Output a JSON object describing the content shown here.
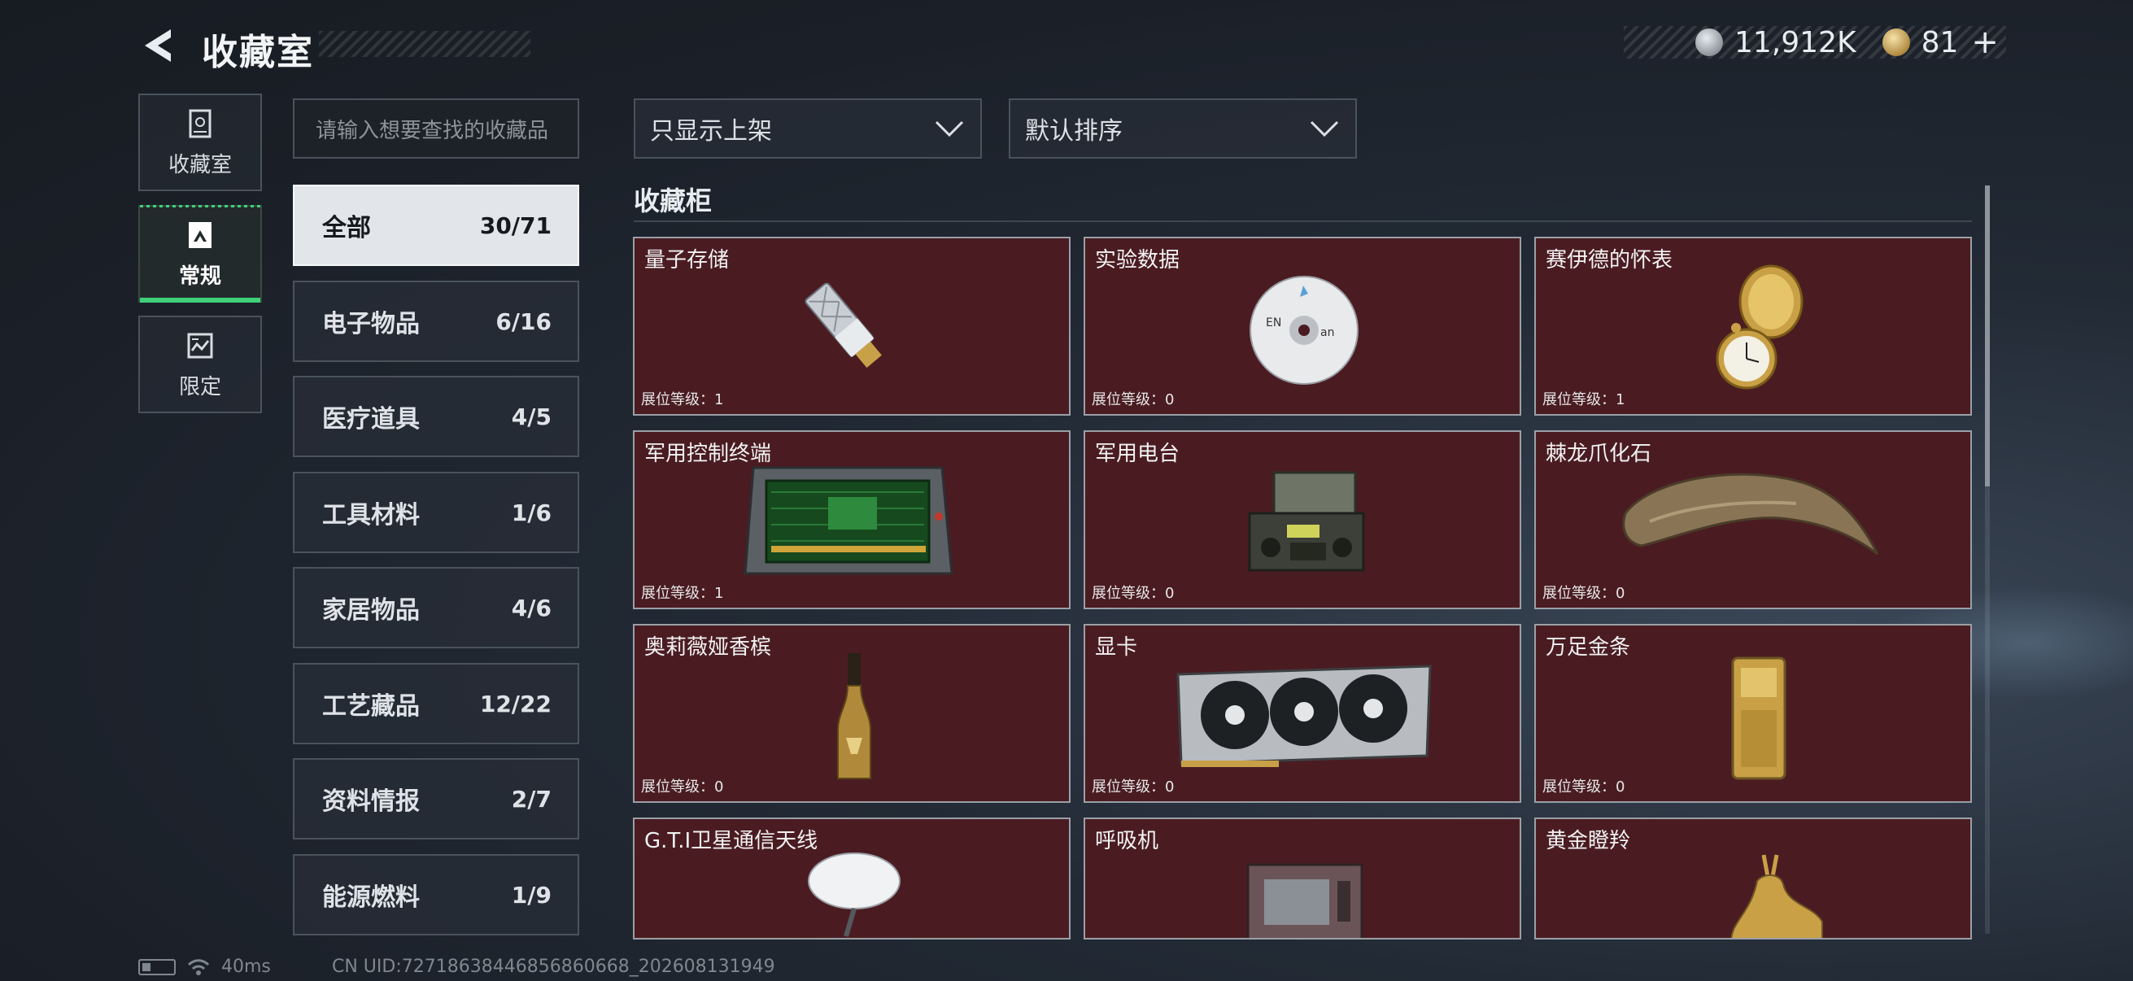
{
  "header": {
    "title": "收藏室",
    "currency": [
      {
        "icon": "silver-coin-icon",
        "value": "11,912K"
      },
      {
        "icon": "gold-coin-icon",
        "value": "81"
      }
    ],
    "add_label": "+"
  },
  "nav": [
    {
      "label": "收藏室",
      "icon": "cabinet-icon",
      "active": false
    },
    {
      "label": "常规",
      "icon": "picture-icon",
      "active": true
    },
    {
      "label": "限定",
      "icon": "limited-icon",
      "active": false
    }
  ],
  "search": {
    "placeholder": "请输入想要查找的收藏品"
  },
  "filters": {
    "display": "只显示上架",
    "sort": "默认排序"
  },
  "categories": [
    {
      "name": "全部",
      "count": "30/71",
      "active": true
    },
    {
      "name": "电子物品",
      "count": "6/16"
    },
    {
      "name": "医疗道具",
      "count": "4/5"
    },
    {
      "name": "工具材料",
      "count": "1/6"
    },
    {
      "name": "家居物品",
      "count": "4/6"
    },
    {
      "name": "工艺藏品",
      "count": "12/22"
    },
    {
      "name": "资料情报",
      "count": "2/7"
    },
    {
      "name": "能源燃料",
      "count": "1/9"
    }
  ],
  "section_title": "收藏柜",
  "items": [
    {
      "name": "量子存储",
      "level": "展位等级：1",
      "icon": "usb-drive-icon"
    },
    {
      "name": "实验数据",
      "level": "展位等级：0",
      "icon": "cd-disc-icon"
    },
    {
      "name": "赛伊德的怀表",
      "level": "展位等级：1",
      "icon": "pocket-watch-icon"
    },
    {
      "name": "军用控制终端",
      "level": "展位等级：1",
      "icon": "control-terminal-icon"
    },
    {
      "name": "军用电台",
      "level": "展位等级：0",
      "icon": "military-radio-icon"
    },
    {
      "name": "棘龙爪化石",
      "level": "展位等级：0",
      "icon": "claw-fossil-icon"
    },
    {
      "name": "奥莉薇娅香槟",
      "level": "展位等级：0",
      "icon": "champagne-bottle-icon"
    },
    {
      "name": "显卡",
      "level": "展位等级：0",
      "icon": "graphics-card-icon"
    },
    {
      "name": "万足金条",
      "level": "展位等级：0",
      "icon": "gold-bar-icon"
    },
    {
      "name": "G.T.I卫星通信天线",
      "level": "",
      "icon": "satellite-dish-icon"
    },
    {
      "name": "呼吸机",
      "level": "",
      "icon": "ventilator-icon"
    },
    {
      "name": "黄金瞪羚",
      "level": "",
      "icon": "gold-gazelle-icon"
    }
  ],
  "footer": {
    "ping": "40ms",
    "uid": "CN UID:72718638446856860668_202608131949"
  }
}
